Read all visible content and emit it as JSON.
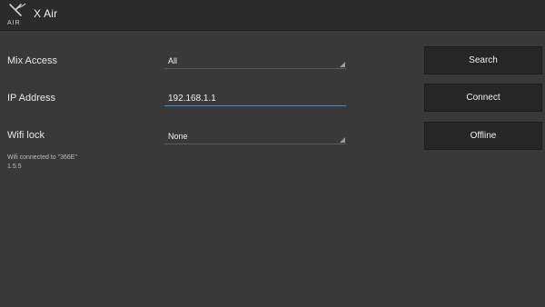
{
  "app": {
    "title": "X Air",
    "logo_text": "X AIR"
  },
  "form": {
    "mix_access": {
      "label": "Mix Access",
      "value": "All"
    },
    "ip_address": {
      "label": "IP Address",
      "value": "192.168.1.1"
    },
    "wifi_lock": {
      "label": "Wifi lock",
      "value": "None"
    }
  },
  "buttons": {
    "search": "Search",
    "connect": "Connect",
    "offline": "Offline"
  },
  "status": {
    "wifi": "Wifi connected to \"366E\"",
    "version": "1.5.5"
  },
  "colors": {
    "background": "#393939",
    "header": "#2b2b2b",
    "button": "#262626",
    "input_accent": "#3f8fbf"
  }
}
